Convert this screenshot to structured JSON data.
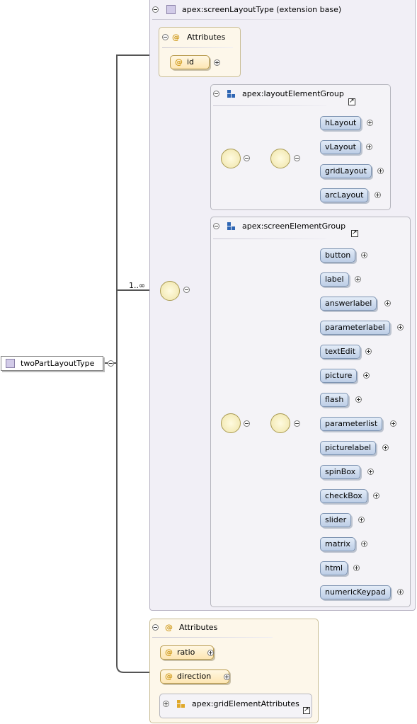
{
  "root": {
    "label": "twoPartLayoutType"
  },
  "multiplicity": "1..∞",
  "extension": {
    "label": "apex:screenLayoutType (extension base)"
  },
  "ext_attributes": {
    "header": "Attributes",
    "items": [
      "id"
    ]
  },
  "layout_group": {
    "label": "apex:layoutElementGroup",
    "elements": [
      "hLayout",
      "vLayout",
      "gridLayout",
      "arcLayout"
    ]
  },
  "screen_group": {
    "label": "apex:screenElementGroup",
    "elements": [
      "button",
      "label",
      "answerlabel",
      "parameterlabel",
      "textEdit",
      "picture",
      "flash",
      "parameterlist",
      "picturelabel",
      "spinBox",
      "checkBox",
      "slider",
      "matrix",
      "html",
      "numericKeypad"
    ]
  },
  "attributes": {
    "header": "Attributes",
    "items": [
      "ratio",
      "direction"
    ],
    "group_ref": "apex:gridElementAttributes"
  },
  "colors": {
    "element_fill": "#c9d8ee",
    "attribute_fill": "#fdeec7",
    "compositor_fill": "#f7f0c4",
    "extension_bg": "#f1eff6"
  }
}
